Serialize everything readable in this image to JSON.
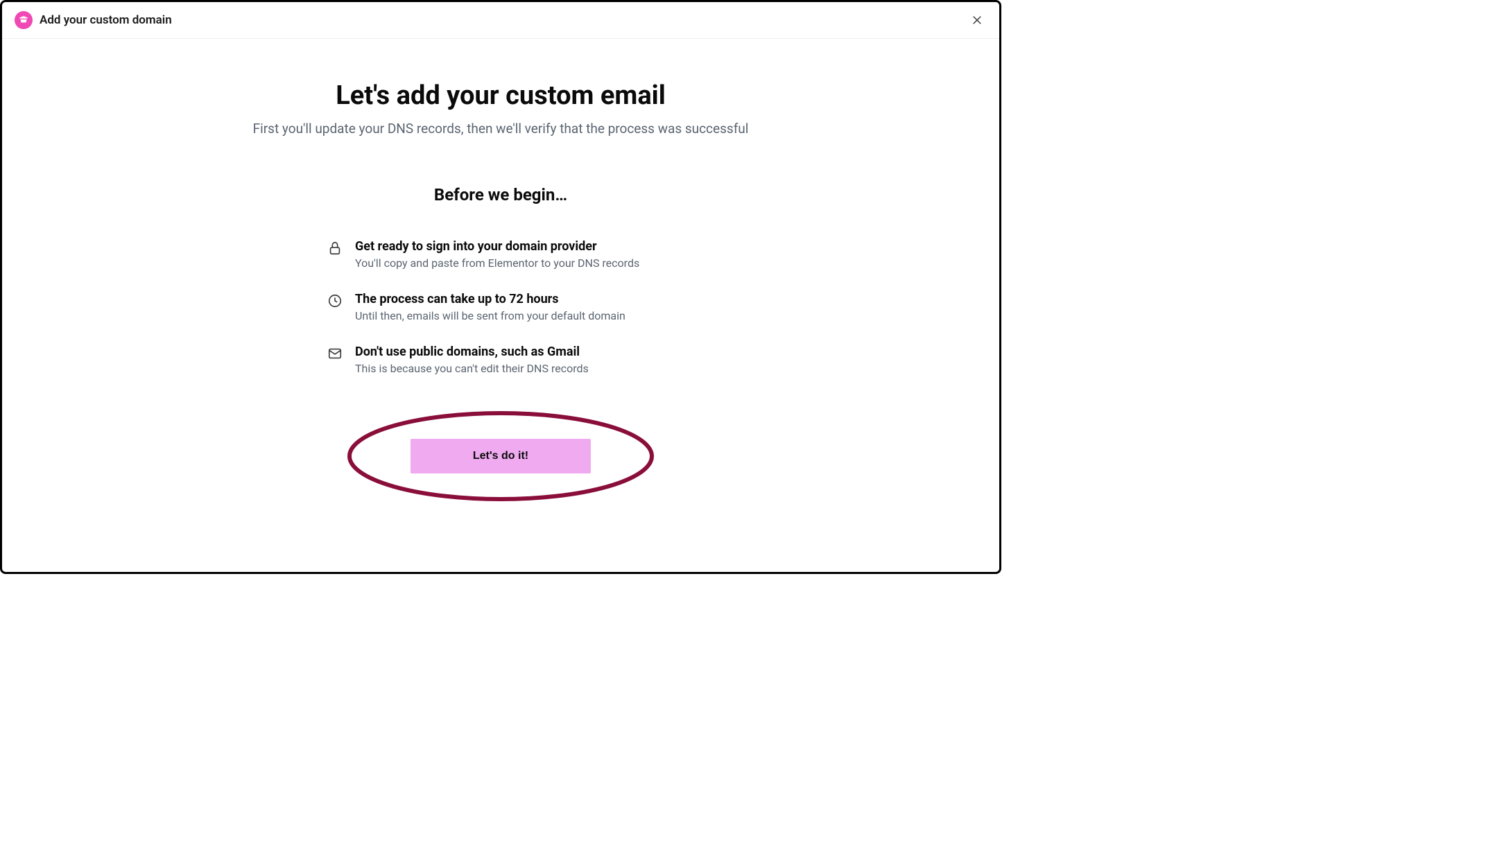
{
  "header": {
    "title": "Add your custom domain"
  },
  "main": {
    "title": "Let's add your custom email",
    "subtitle": "First you'll update your DNS records, then we'll verify that the process was successful",
    "section_title": "Before we begin…"
  },
  "checklist": [
    {
      "icon": "lock",
      "title": "Get ready to sign into your domain provider",
      "description": "You'll copy and paste from Elementor to your DNS records"
    },
    {
      "icon": "clock",
      "title": "The process can take up to 72 hours",
      "description": "Until then, emails will be sent from your default domain"
    },
    {
      "icon": "mail",
      "title": "Don't use public domains, such as Gmail",
      "description": "This is because you can't edit their DNS records"
    }
  ],
  "cta": {
    "label": "Let's do it!"
  }
}
